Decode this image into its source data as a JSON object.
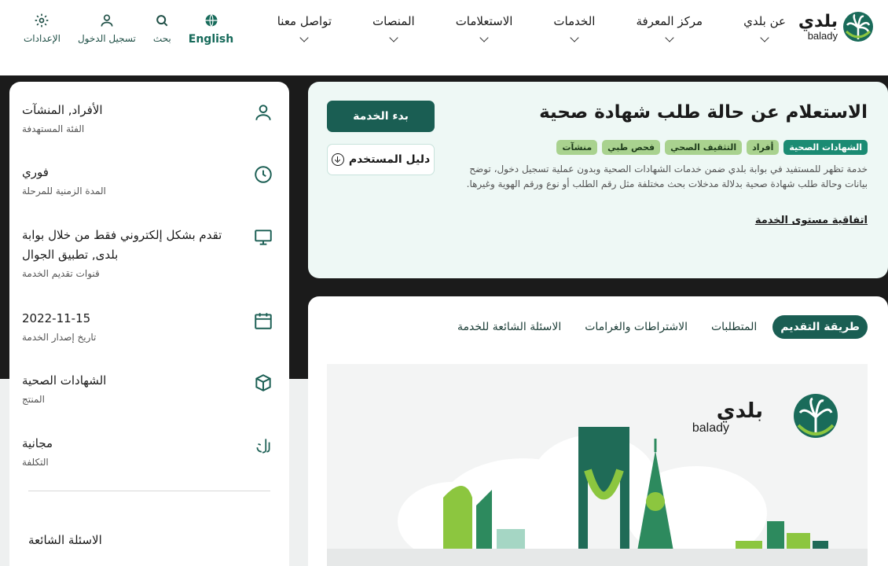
{
  "brand": {
    "name_ar": "بلدي",
    "name_en": "balady"
  },
  "nav": {
    "items": [
      {
        "label": "عن بلدي"
      },
      {
        "label": "مركز المعرفة"
      },
      {
        "label": "الخدمات"
      },
      {
        "label": "الاستعلامات"
      },
      {
        "label": "المنصات"
      },
      {
        "label": "تواصل معنا"
      }
    ]
  },
  "tools": {
    "language": "English",
    "search": "بحث",
    "login": "تسجيل الدخول",
    "settings": "الإعدادات"
  },
  "service": {
    "title": "الاستعلام عن حالة طلب شهادة صحية",
    "tags": [
      "الشهادات الصحية",
      "أفراد",
      "التثقيف الصحي",
      "فحص طبي",
      "منشآت"
    ],
    "description": "خدمة تظهر للمستفيد في بوابة بلدي ضمن خدمات الشهادات الصحية وبدون عملية تسجيل دخول، توضح بيانات وحالة طلب شهادة صحية بدلالة مدخلات بحث مختلفة مثل رقم الطلب أو نوع ورقم الهوية وغيرها.",
    "sla_link": "اتفاقية مستوى الخدمة",
    "start_button": "بدء الخدمة",
    "guide_button": "دليل المستخدم"
  },
  "tabs": [
    {
      "label": "طريقة التقديم",
      "active": true
    },
    {
      "label": "المتطلبات",
      "active": false
    },
    {
      "label": "الاشتراطات والغرامات",
      "active": false
    },
    {
      "label": "الاسئلة الشائعة للخدمة",
      "active": false
    }
  ],
  "sidebar": {
    "items": [
      {
        "icon": "user-icon",
        "value": "الأفراد, المنشآت",
        "label": "الفئة المستهدفة"
      },
      {
        "icon": "clock-icon",
        "value": "فوري",
        "label": "المدة الزمنية للمرحلة"
      },
      {
        "icon": "monitor-icon",
        "value": "تقدم بشكل إلكتروني فقط من خلال بوابة بلدى, تطبيق الجوال",
        "label": "قنوات تقديم الخدمة"
      },
      {
        "icon": "calendar-icon",
        "value": "2022-11-15",
        "label": "تاريخ إصدار الخدمة"
      },
      {
        "icon": "box-icon",
        "value": "الشهادات الصحية",
        "label": "المنتج"
      },
      {
        "icon": "riyal-icon",
        "value": "مجانية",
        "label": "التكلفة"
      }
    ],
    "faq_title": "الاسئلة الشائعة"
  },
  "colors": {
    "primary": "#1a5e53",
    "accent": "#1b8b73",
    "tag": "#a9d28f",
    "dark_band": "#1b1b1b"
  }
}
